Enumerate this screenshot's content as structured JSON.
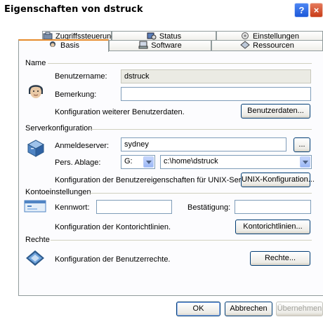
{
  "window": {
    "title": "Eigenschaften von dstruck",
    "help": "?",
    "close": "×"
  },
  "tabs_row1": [
    {
      "label": "Zugriffssteuerung",
      "icon": "access-control-icon"
    },
    {
      "label": "Status",
      "icon": "status-icon"
    },
    {
      "label": "Einstellungen",
      "icon": "settings-icon"
    }
  ],
  "tabs_row2": [
    {
      "label": "Basis",
      "icon": "user-icon",
      "active": true
    },
    {
      "label": "Software",
      "icon": "software-icon"
    },
    {
      "label": "Ressourcen",
      "icon": "resources-icon"
    }
  ],
  "name_section": {
    "title": "Name",
    "username_label": "Benutzername:",
    "username_value": "dstruck",
    "comment_label": "Bemerkung:",
    "comment_value": "",
    "config_text": "Konfiguration weiterer Benutzerdaten.",
    "button": "Benutzerdaten..."
  },
  "server_section": {
    "title": "Serverkonfiguration",
    "logon_label": "Anmeldeserver:",
    "logon_value": "sydney",
    "browse_button": "...",
    "storage_label": "Pers. Ablage:",
    "drive_value": "G:",
    "path_value": "c:\\home\\dstruck",
    "config_text": "Konfiguration der Benutzereigenschaften für UNIX-Server.",
    "button": "UNIX-Konfiguration..."
  },
  "account_section": {
    "title": "Kontoeinstellungen",
    "password_label": "Kennwort:",
    "confirm_label": "Bestätigung:",
    "config_text": "Konfiguration der Kontorichtlinien.",
    "button": "Kontorichtlinien..."
  },
  "rights_section": {
    "title": "Rechte",
    "config_text": "Konfiguration der Benutzerrechte.",
    "button": "Rechte..."
  },
  "footer": {
    "ok": "OK",
    "cancel": "Abbrechen",
    "apply": "Übernehmen"
  }
}
